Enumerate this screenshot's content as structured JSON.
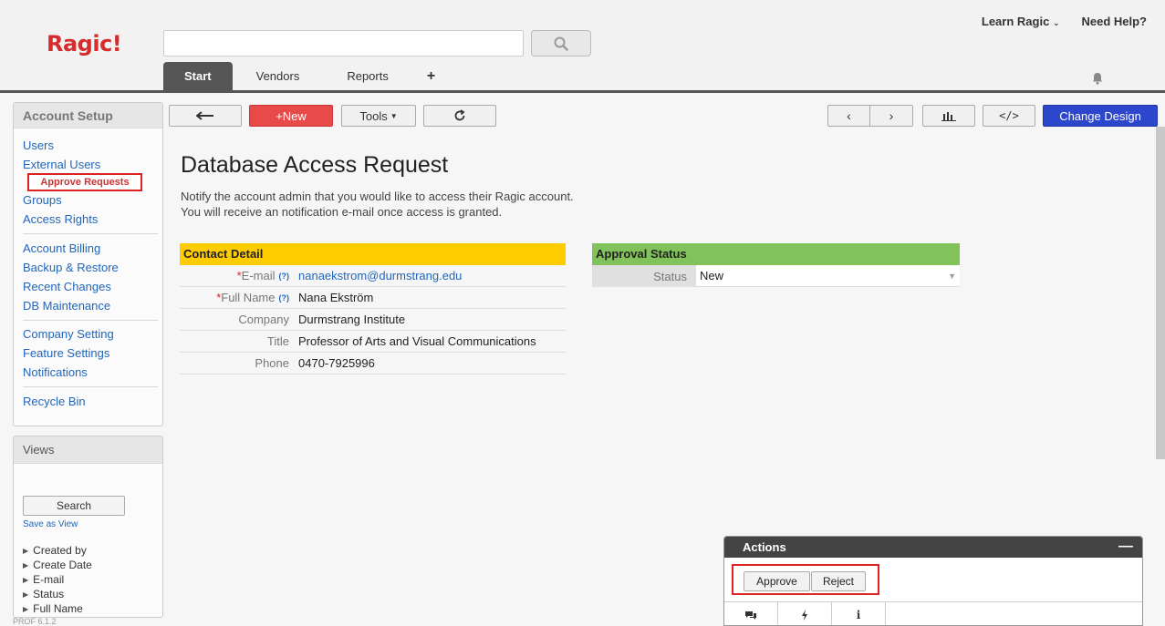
{
  "app": {
    "logo": "Ragic!",
    "version": "PROF 6.1.2"
  },
  "header": {
    "search_placeholder": "",
    "tabs": [
      {
        "label": "Start"
      },
      {
        "label": "Vendors"
      },
      {
        "label": "Reports"
      },
      {
        "label": "+"
      }
    ],
    "learn_label": "Learn Ragic",
    "help_label": "Need Help?"
  },
  "sidebar": {
    "title": "Account Setup",
    "items": [
      {
        "label": "Users"
      },
      {
        "label": "External Users"
      },
      {
        "label": "Approve Requests"
      },
      {
        "label": "Groups"
      },
      {
        "label": "Access Rights"
      },
      {
        "label": "Account Billing"
      },
      {
        "label": "Backup & Restore"
      },
      {
        "label": "Recent Changes"
      },
      {
        "label": "DB Maintenance"
      },
      {
        "label": "Company Setting"
      },
      {
        "label": "Feature Settings"
      },
      {
        "label": "Notifications"
      },
      {
        "label": "Recycle Bin"
      }
    ]
  },
  "views": {
    "title": "Views",
    "search_label": "Search",
    "save_label": "Save as View",
    "filters": [
      "Created by",
      "Create Date",
      "E-mail",
      "Status",
      "Full Name"
    ]
  },
  "toolbar": {
    "new_label": "+New",
    "tools_label": "Tools",
    "change_design_label": "Change Design"
  },
  "form": {
    "title": "Database Access Request",
    "desc_line1": "Notify the account admin that you would like to access their Ragic account.",
    "desc_line2": "You will receive an notification e-mail once access is granted.",
    "contact": {
      "header": "Contact Detail",
      "header_color": "#ffcc00",
      "fields": [
        {
          "label": "E-mail",
          "required": "*",
          "help": "(?)",
          "value": "nanaekstrom@durmstrang.edu"
        },
        {
          "label": "Full Name",
          "required": "*",
          "help": "(?)",
          "value": "Nana Ekström"
        },
        {
          "label": "Company",
          "value": "Durmstrang Institute"
        },
        {
          "label": "Title",
          "value": "Professor of Arts and Visual Communications"
        },
        {
          "label": "Phone",
          "value": "0470-7925996"
        }
      ]
    },
    "approval": {
      "header": "Approval Status",
      "header_color": "#82c25a",
      "status_label": "Status",
      "status_value": "New"
    }
  },
  "actions": {
    "title": "Actions",
    "minimize": "—",
    "approve_label": "Approve",
    "reject_label": "Reject"
  },
  "colors": {
    "accent_blue": "#2d47cc",
    "new_red": "#e84a4a",
    "link_blue": "#2266bb"
  }
}
